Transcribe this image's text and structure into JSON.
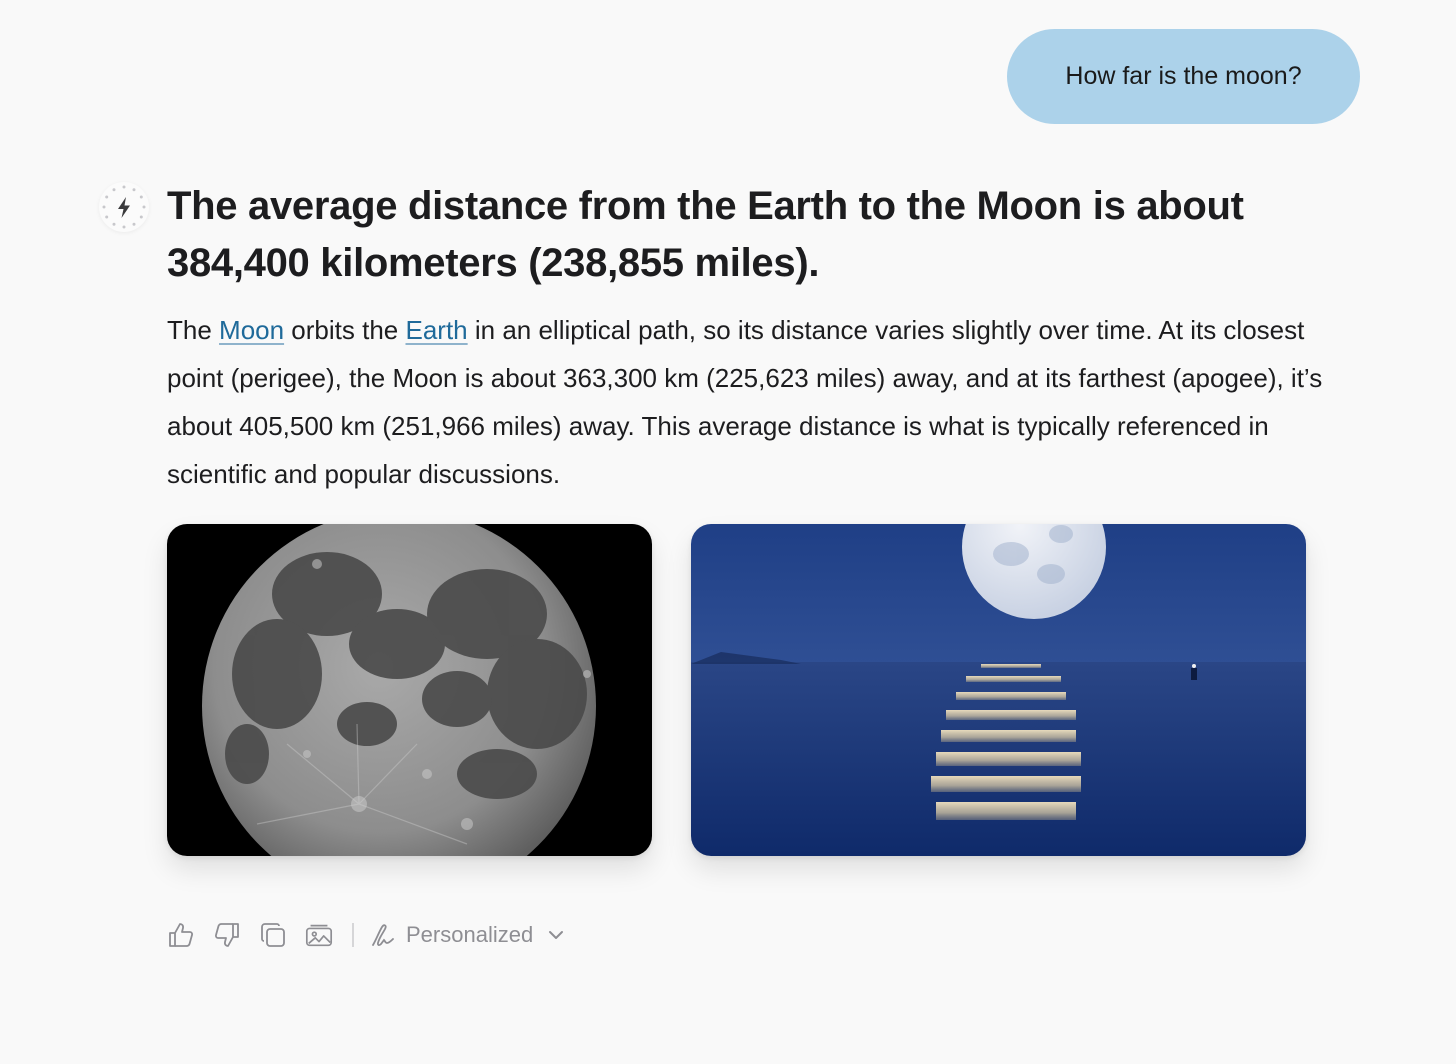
{
  "conversation": {
    "user_message": "How far is the moon?",
    "answer": {
      "headline": "The average distance from the Earth to the Moon is about 384,400 kilometers (238,855 miles).",
      "body": {
        "part1": "The ",
        "link1": "Moon",
        "part2": " orbits the ",
        "link2": "Earth",
        "part3": " in an elliptical path, so its distance varies slightly over time. At its closest point (perigee), the Moon is about 363,300 km (225,623 miles) away, and at its farthest (apogee), it’s about 405,500 km (251,966 miles) away. This average distance is what is typically referenced in scientific and popular discussions."
      }
    }
  },
  "actions": {
    "icons": [
      "thumbs-up-icon",
      "thumbs-down-icon",
      "copy-icon",
      "image-icon"
    ],
    "personalized_label": "Personalized"
  },
  "colors": {
    "page_bg": "#f9f9f9",
    "user_bubble_bg": "#acd2ea",
    "link": "#1f6a9a",
    "muted": "#8e8e93"
  }
}
